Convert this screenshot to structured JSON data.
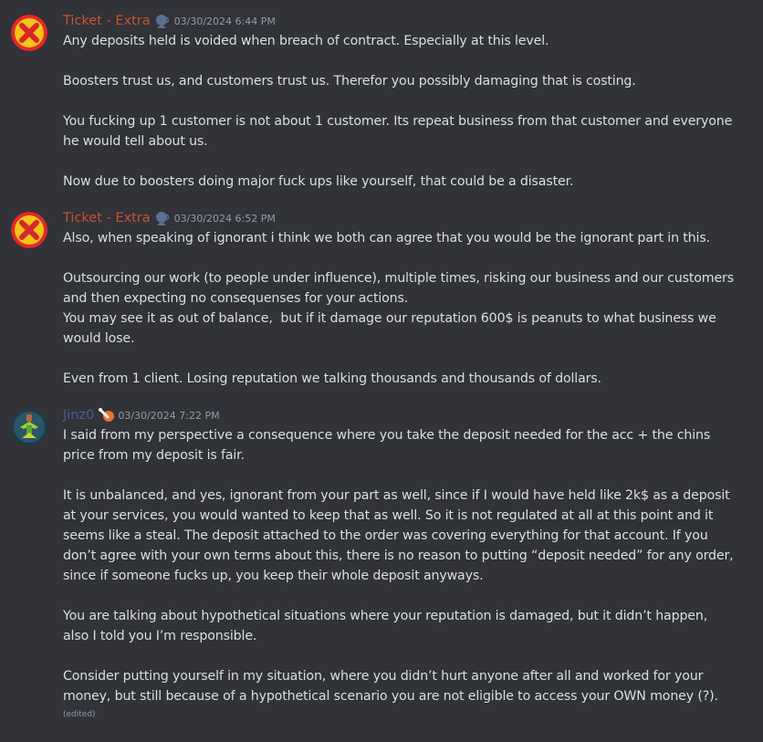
{
  "colors": {
    "background": "#313338",
    "text": "#dbdee1",
    "timestamp": "#949ba4",
    "ticket_name": "#c7532f",
    "jinz_name": "#4e5d94"
  },
  "messages": [
    {
      "author": "Ticket - Extra",
      "role_icon": "speaking-head-icon",
      "timestamp": "03/30/2024 6:44 PM",
      "paragraphs": [
        "Any deposits held is voided when breach of contract. Especially at this level.",
        "",
        "Boosters trust us, and customers trust us. Therefor you possibly damaging that is costing.",
        "",
        "You fucking up 1 customer is not about 1 customer. Its repeat business from that customer and everyone he would tell about us.",
        "",
        "Now due to boosters doing major fuck ups like yourself, that could be a disaster."
      ]
    },
    {
      "author": "Ticket - Extra",
      "role_icon": "speaking-head-icon",
      "timestamp": "03/30/2024 6:52 PM",
      "paragraphs": [
        "Also, when speaking of ignorant i think we both can agree that you would be the ignorant part in this.",
        "",
        "Outsourcing our work (to people under influence), multiple times, risking our business and our customers and then expecting no consequenses for your actions.",
        "You may see it as out of balance,  but if it damage our reputation 600$ is peanuts to what business we would lose.",
        "",
        "Even from 1 client. Losing reputation we talking thousands and thousands of dollars."
      ]
    },
    {
      "author": "Jinz0",
      "role_icon": "bone-badge-icon",
      "timestamp": "03/30/2024 7:22 PM",
      "paragraphs": [
        "I said from my perspective a consequence where you take the deposit needed for the acc + the chins price from my deposit is fair.",
        "",
        "It is unbalanced, and yes, ignorant from your part as well, since if I would have held like 2k$ as a deposit at your services, you would wanted to keep that as well. So it is not regulated at all at this point and it seems like a steal. The deposit attached to the order was covering everything for that account. If you don’t agree with your own terms about this, there is no reason to putting “deposit needed” for any order, since if someone fucks up, you keep their whole deposit anyways.",
        "",
        "You are talking about hypothetical situations where your reputation is damaged, but it didn’t happen, also I told you I’m responsible.",
        "",
        "Consider putting yourself in my situation, where you didn’t hurt anyone after all and worked for your money, but still because of a hypothetical scenario you are not eligible to access your OWN money (?)."
      ],
      "edited": "(edited)"
    }
  ]
}
